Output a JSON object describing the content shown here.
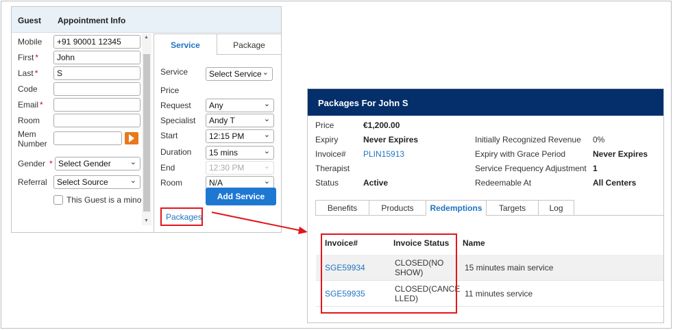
{
  "guest_window": {
    "header": {
      "guest_tab": "Guest",
      "appointment_tab": "Appointment Info"
    },
    "fields": {
      "mobile": {
        "label": "Mobile",
        "value": "+91 90001 12345"
      },
      "first": {
        "label": "First",
        "value": "John"
      },
      "last": {
        "label": "Last",
        "value": "S"
      },
      "code": {
        "label": "Code",
        "value": ""
      },
      "email": {
        "label": "Email",
        "value": ""
      },
      "room": {
        "label": "Room",
        "value": ""
      },
      "mem_number": {
        "label_line1": "Mem",
        "label_line2": "Number",
        "value": ""
      },
      "gender": {
        "label": "Gender",
        "value": "Select Gender"
      },
      "referral": {
        "label": "Referral",
        "value": "Select Source"
      }
    },
    "required_marker": "*",
    "minor_checkbox_label": "This Guest is a minor"
  },
  "service_panel": {
    "tabs": [
      "Service",
      "Package"
    ],
    "rows": {
      "service": {
        "label": "Service",
        "value": "Select Service"
      },
      "price": {
        "label": "Price",
        "value": ""
      },
      "request": {
        "label": "Request",
        "value": "Any"
      },
      "specialist": {
        "label": "Specialist",
        "value": "Andy T"
      },
      "start": {
        "label": "Start",
        "value": "12:15 PM"
      },
      "duration": {
        "label": "Duration",
        "value": "15 mins"
      },
      "end": {
        "label": "End",
        "value": "12:30 PM"
      },
      "room": {
        "label": "Room",
        "value": "N/A"
      }
    },
    "add_service_label": "Add Service",
    "packages_link": "Packages"
  },
  "package_window": {
    "title": "Packages For John S",
    "left_info": [
      {
        "label": "Price",
        "value": "€1,200.00"
      },
      {
        "label": "Expiry",
        "value": "Never Expires"
      },
      {
        "label": "Invoice#",
        "value": "PLIN15913"
      },
      {
        "label": "Therapist",
        "value": ""
      },
      {
        "label": "Status",
        "value": "Active"
      }
    ],
    "right_info": [
      {
        "label": "Initially Recognized Revenue",
        "value": "0%"
      },
      {
        "label": "Expiry with Grace Period",
        "value": "Never Expires"
      },
      {
        "label": "Service Frequency Adjustment",
        "value": "1"
      },
      {
        "label": "Redeemable At",
        "value": "All Centers"
      }
    ],
    "tabs": [
      "Benefits",
      "Products",
      "Redemptions",
      "Targets",
      "Log"
    ],
    "active_tab": "Redemptions",
    "table": {
      "headers": [
        "Invoice#",
        "Invoice Status",
        "Name"
      ],
      "rows": [
        {
          "invoice": "SGE59934",
          "status_line1": "CLOSED(NO",
          "status_line2": "SHOW)",
          "name": "15 minutes main service"
        },
        {
          "invoice": "SGE59935",
          "status_line1": "CLOSED(CANCE",
          "status_line2": "LLED)",
          "name": "11 minutes service"
        }
      ]
    }
  },
  "colors": {
    "accent_blue": "#1e74c2",
    "header_navy": "#052f6b",
    "highlight_red": "#e1151b",
    "button_orange": "#e8781c",
    "button_blue": "#1e78d2"
  }
}
